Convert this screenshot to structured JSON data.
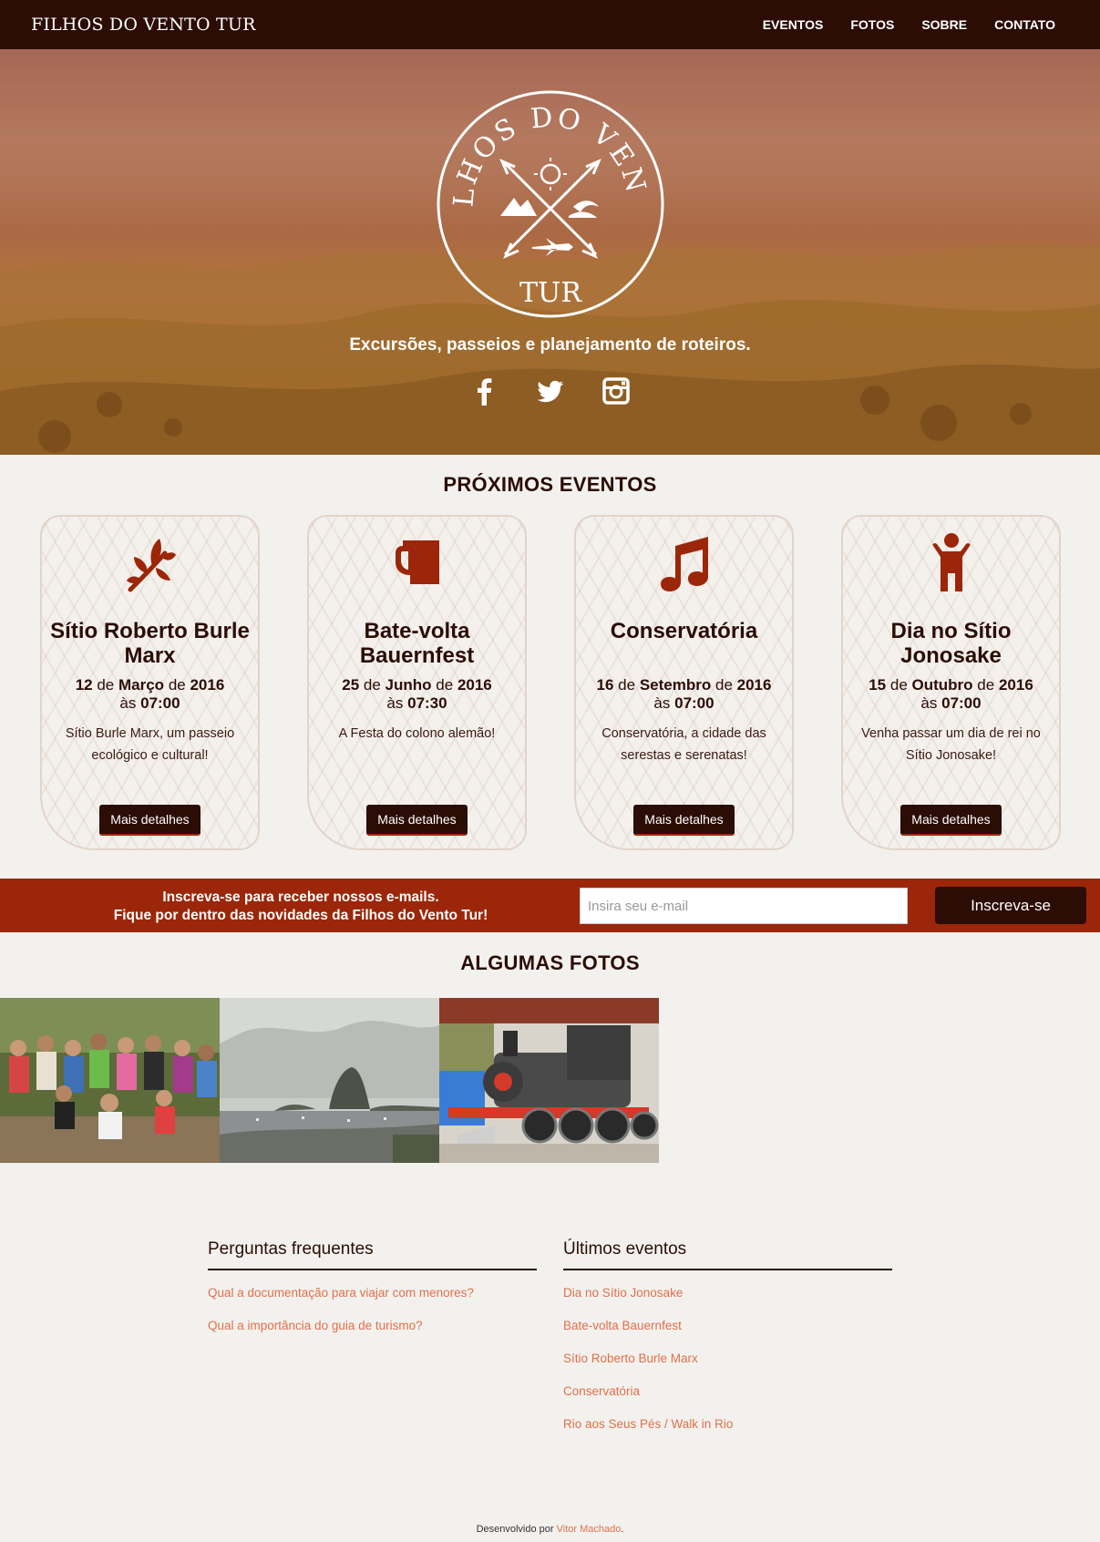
{
  "nav": {
    "brand": "FILHOS DO VENTO TUR",
    "links": [
      "EVENTOS",
      "FOTOS",
      "SOBRE",
      "CONTATO"
    ]
  },
  "hero": {
    "logo_top_text": "FILHOS DO VENTO",
    "logo_bottom_text": "TUR",
    "tagline": "Excursões, passeios e planejamento de roteiros.",
    "socials": [
      "facebook-icon",
      "twitter-icon",
      "instagram-icon"
    ]
  },
  "events": {
    "title": "PRÓXIMOS EVENTOS",
    "items": [
      {
        "icon": "leaf-icon",
        "title": "Sítio Roberto Burle Marx",
        "day": "12",
        "de1": "de",
        "month": "Março",
        "de2": "de",
        "year": "2016",
        "at": "às",
        "time": "07:00",
        "desc": "Sítio Burle Marx, um passeio ecológico e cultural!",
        "button": "Mais detalhes"
      },
      {
        "icon": "beer-mug-icon",
        "title": "Bate-volta Bauernfest",
        "day": "25",
        "de1": "de",
        "month": "Junho",
        "de2": "de",
        "year": "2016",
        "at": "às",
        "time": "07:30",
        "desc": "A Festa do colono alemão!",
        "button": "Mais detalhes"
      },
      {
        "icon": "music-note-icon",
        "title": "Conservatória",
        "day": "16",
        "de1": "de",
        "month": "Setembro",
        "de2": "de",
        "year": "2016",
        "at": "às",
        "time": "07:00",
        "desc": "Conservatória, a cidade das serestas e serenatas!",
        "button": "Mais detalhes"
      },
      {
        "icon": "person-icon",
        "title": "Dia no Sítio Jonosake",
        "day": "15",
        "de1": "de",
        "month": "Outubro",
        "de2": "de",
        "year": "2016",
        "at": "às",
        "time": "07:00",
        "desc": "Venha passar um dia de rei no Sítio Jonosake!",
        "button": "Mais detalhes"
      }
    ]
  },
  "newsletter": {
    "line1": "Inscreva-se para receber nossos e-mails.",
    "line2": "Fique por dentro das novidades da Filhos do Vento Tur!",
    "placeholder": "Insira seu e-mail",
    "button": "Inscreva-se"
  },
  "photos": {
    "title": "ALGUMAS FOTOS"
  },
  "faq": {
    "title": "Perguntas frequentes",
    "links": [
      "Qual a documentação para viajar com menores?",
      "Qual a importância do guia de turismo?"
    ]
  },
  "recent": {
    "title": "Últimos eventos",
    "links": [
      "Dia no Sítio Jonosake",
      "Bate-volta Bauernfest",
      "Sítio Roberto Burle Marx",
      "Conservatória",
      "Rio aos Seus Pés / Walk in Rio"
    ]
  },
  "footer": {
    "prefix": "Desenvolvido por",
    "author": "Vitor Machado",
    "suffix": "."
  },
  "colors": {
    "dark_brown": "#2b0d05",
    "rust": "#9c2609",
    "link": "#e0704a",
    "icon": "#9c2609"
  }
}
